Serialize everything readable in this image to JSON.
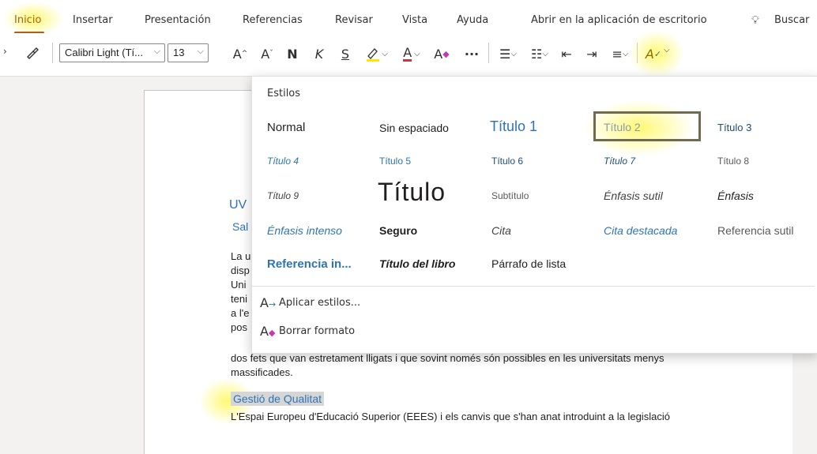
{
  "tabs": [
    "Inicio",
    "Insertar",
    "Presentación",
    "Referencias",
    "Revisar",
    "Vista",
    "Ayuda"
  ],
  "open_desktop": "Abrir en la aplicación de escritorio",
  "search_label": "Buscar",
  "toolbar": {
    "font_name": "Calibri Light (Tí...",
    "font_size": "13",
    "grow_font": "A",
    "shrink_font": "A",
    "bold": "N",
    "italic": "K",
    "underline": "S",
    "font_color": "A",
    "more": "···"
  },
  "colors": {
    "accent": "#b05c1d",
    "heading_blue": "#2e74b5",
    "highlight": "#fff85a"
  },
  "document": {
    "lines": [
      "La u",
      "disp",
      "Uni",
      "teni",
      "a l'e",
      "pos",
      "dos fets que van estretament lligats i que sovint només són possibles en les universitats menys",
      "massificades."
    ],
    "heading_frag": "UV",
    "sub_frag": "Sal",
    "section_heading": "Gestió de Qualitat",
    "body_last": "L'Espai Europeu d'Educació Superior (EEES) i els canvis que s'han anat introduint a la legislació"
  },
  "styles_panel": {
    "title": "Estilos",
    "items": {
      "normal": "Normal",
      "sin_espaciado": "Sin espaciado",
      "titulo1": "Título 1",
      "titulo2": "Título 2",
      "titulo3": "Título 3",
      "titulo4": "Título 4",
      "titulo5": "Título 5",
      "titulo6": "Título 6",
      "titulo7": "Título 7",
      "titulo8": "Título 8",
      "titulo9": "Título 9",
      "titulo": "Título",
      "subtitulo": "Subtítulo",
      "enfasis_sutil": "Énfasis sutil",
      "enfasis": "Énfasis",
      "enfasis_intenso": "Énfasis intenso",
      "seguro": "Seguro",
      "cita": "Cita",
      "cita_destacada": "Cita destacada",
      "referencia_sutil": "Referencia sutil",
      "referencia_intensa": "Referencia in...",
      "titulo_libro": "Título del libro",
      "parrafo_lista": "Párrafo de lista"
    },
    "selected": "Título 2",
    "apply_styles": "Aplicar estilos...",
    "clear_format": "Borrar formato"
  }
}
